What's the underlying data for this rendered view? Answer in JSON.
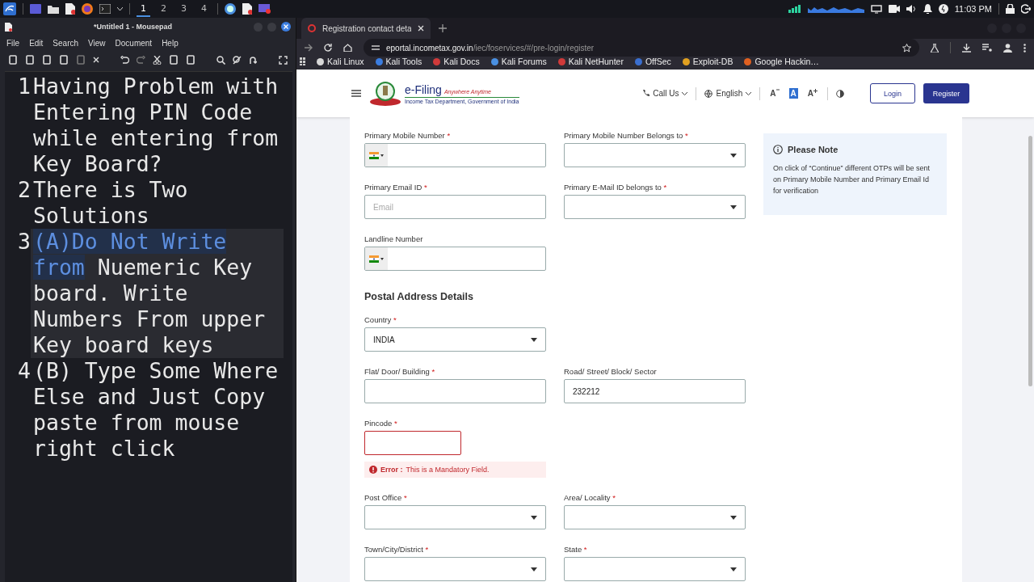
{
  "taskbar": {
    "workspaces": [
      {
        "label": "1",
        "selected": true
      },
      {
        "label": "2",
        "selected": false
      },
      {
        "label": "3",
        "selected": false
      },
      {
        "label": "4",
        "selected": false
      }
    ],
    "clock": "11:03 PM"
  },
  "editor": {
    "title": "*Untitled 1 - Mousepad",
    "menu": [
      "File",
      "Edit",
      "Search",
      "View",
      "Document",
      "Help"
    ],
    "lines": [
      {
        "number": "1",
        "current": false,
        "segments": [
          {
            "text": "Having Problem with Entering PIN Code while entering from Key Board?",
            "selected": false
          }
        ]
      },
      {
        "number": "2",
        "current": false,
        "segments": [
          {
            "text": "There is Two Solutions",
            "selected": false
          }
        ]
      },
      {
        "number": "3",
        "current": true,
        "segments": [
          {
            "text": "(A)Do Not Write from",
            "selected": true
          },
          {
            "text": " Nuemeric Key board. Write Numbers From upper Key board keys",
            "selected": false
          }
        ]
      },
      {
        "number": "4",
        "current": false,
        "segments": [
          {
            "text": "(B) Type Some Where Else and Just Copy paste from mouse right click",
            "selected": false
          }
        ]
      }
    ]
  },
  "browser": {
    "tab_title": "Registration contact deta",
    "url_host": "eportal.incometax.gov.in",
    "url_path": "/iec/foservices/#/pre-login/register",
    "bookmarks": [
      {
        "label": "Kali Linux",
        "color": "#d8d8d8"
      },
      {
        "label": "Kali Tools",
        "color": "#3b7de0"
      },
      {
        "label": "Kali Docs",
        "color": "#d03a3a"
      },
      {
        "label": "Kali Forums",
        "color": "#4a90e2"
      },
      {
        "label": "Kali NetHunter",
        "color": "#d03a3a"
      },
      {
        "label": "OffSec",
        "color": "#3a6fd0"
      },
      {
        "label": "Exploit-DB",
        "color": "#e0a020"
      },
      {
        "label": "Google Hackin…",
        "color": "#e06020"
      }
    ]
  },
  "site_header": {
    "logo_title": "e-Filing",
    "logo_tagline": "Anywhere Anytime",
    "logo_subtitle": "Income Tax Department, Government of India",
    "call_us": "Call Us",
    "language": "English",
    "font_buttons": [
      {
        "label": "A",
        "kind": "decrease",
        "selected": false
      },
      {
        "label": "A",
        "kind": "normal",
        "selected": true
      },
      {
        "label": "A",
        "kind": "increase",
        "selected": false
      }
    ],
    "login": "Login",
    "register": "Register"
  },
  "form": {
    "sections": [
      {
        "rows": [
          [
            {
              "label": "Primary Mobile Number",
              "required_mark": "*",
              "kind": "phone"
            },
            {
              "label": "Primary Mobile Number Belongs to",
              "required_mark": "*",
              "kind": "select"
            }
          ],
          [
            {
              "label": "Primary Email ID",
              "required_mark": "*",
              "kind": "text",
              "placeholder": "Email"
            },
            {
              "label": "Primary E-Mail ID belongs to",
              "required_mark": "*",
              "kind": "select"
            }
          ],
          [
            {
              "label": "Landline Number",
              "kind": "phone"
            }
          ]
        ]
      },
      {
        "heading": "Postal Address Details",
        "rows": [
          [
            {
              "label": "Country",
              "required_mark": "*",
              "kind": "select",
              "value": "INDIA"
            }
          ],
          [
            {
              "label": "Flat/ Door/ Building",
              "required_mark": "*",
              "kind": "text"
            },
            {
              "label": "Road/ Street/ Block/ Sector",
              "kind": "text",
              "value": "232212"
            }
          ],
          [
            {
              "label": "Pincode",
              "required_mark": "*",
              "kind": "short",
              "error": {
                "label": "Error :",
                "message": "This is a Mandatory Field."
              }
            }
          ],
          [
            {
              "label": "Post Office",
              "required_mark": "*",
              "kind": "select"
            },
            {
              "label": "Area/ Locality",
              "required_mark": "*",
              "kind": "select"
            }
          ],
          [
            {
              "label": "Town/City/District",
              "required_mark": "*",
              "kind": "select"
            },
            {
              "label": "State",
              "required_mark": "*",
              "kind": "select"
            }
          ]
        ]
      }
    ],
    "note": {
      "title": "Please Note",
      "text": "On click of “Continue” different OTPs will be sent on Primary Mobile Number and Primary Email Id for verification"
    }
  }
}
